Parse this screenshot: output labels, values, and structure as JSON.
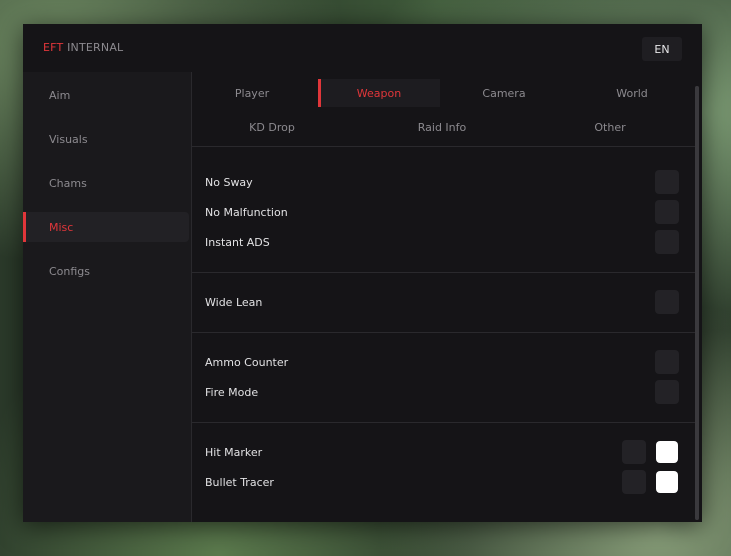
{
  "app": {
    "brand_primary": "EFT",
    "brand_secondary": "INTERNAL",
    "language": "EN",
    "accent_color": "#e0363a"
  },
  "sidebar": {
    "items": [
      {
        "label": "Aim"
      },
      {
        "label": "Visuals"
      },
      {
        "label": "Chams"
      },
      {
        "label": "Misc",
        "active": true
      },
      {
        "label": "Configs"
      }
    ]
  },
  "tabs": {
    "row1": [
      {
        "label": "Player"
      },
      {
        "label": "Weapon",
        "active": true
      },
      {
        "label": "Camera"
      },
      {
        "label": "World"
      }
    ],
    "row2": [
      {
        "label": "KD Drop"
      },
      {
        "label": "Raid Info"
      },
      {
        "label": "Other"
      }
    ]
  },
  "settings": {
    "no_sway": {
      "label": "No Sway",
      "enabled": false
    },
    "no_malfunction": {
      "label": "No Malfunction",
      "enabled": false
    },
    "instant_ads": {
      "label": "Instant ADS",
      "enabled": false
    },
    "wide_lean": {
      "label": "Wide Lean",
      "enabled": false
    },
    "ammo_counter": {
      "label": "Ammo Counter",
      "enabled": false
    },
    "fire_mode": {
      "label": "Fire Mode",
      "enabled": false
    },
    "hit_marker": {
      "label": "Hit Marker",
      "enabled": false,
      "color": "#ffffff"
    },
    "bullet_tracer": {
      "label": "Bullet Tracer",
      "enabled": false,
      "color": "#ffffff"
    }
  }
}
